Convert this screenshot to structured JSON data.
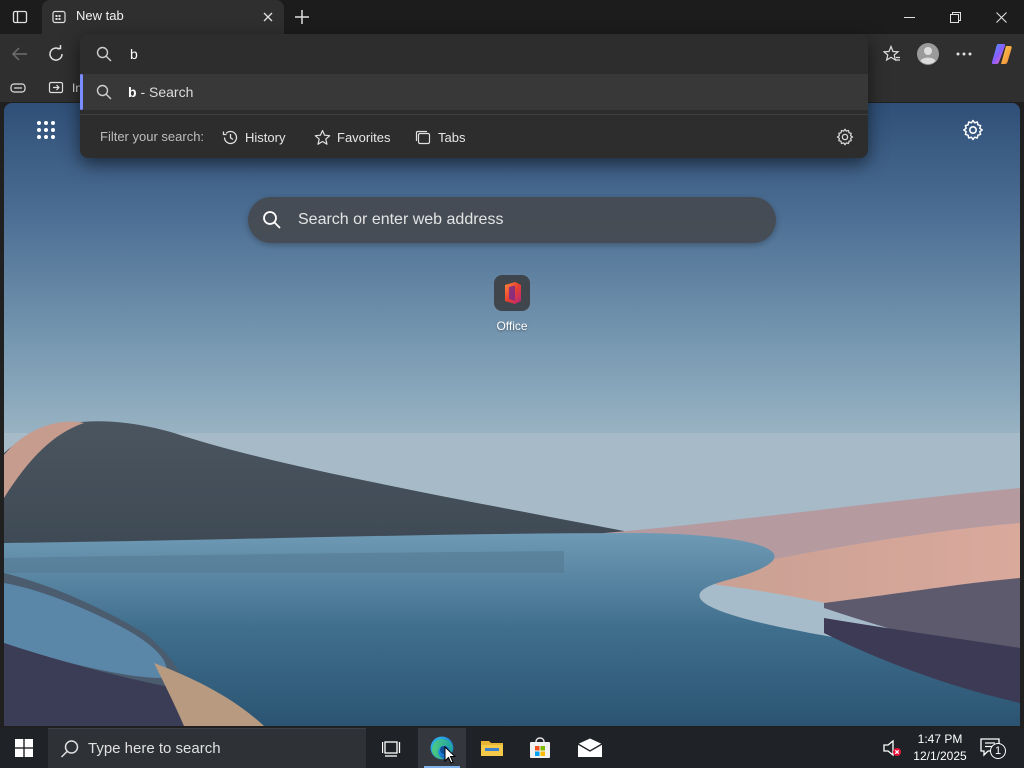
{
  "browser": {
    "tab": {
      "title": "New tab"
    },
    "favorites_bar": {
      "partial_label": "In"
    },
    "omnibox": {
      "typed_text": "b",
      "suggestion": {
        "bold": "b",
        "rest": " - Search"
      },
      "filter_label": "Filter your search:",
      "filters": [
        {
          "label": "History",
          "icon": "history-icon"
        },
        {
          "label": "Favorites",
          "icon": "star-icon"
        },
        {
          "label": "Tabs",
          "icon": "tabs-icon"
        }
      ]
    },
    "new_tab_page": {
      "search_placeholder": "Search or enter web address",
      "tiles": [
        {
          "label": "Office",
          "icon": "office-icon"
        }
      ]
    }
  },
  "taskbar": {
    "search_placeholder": "Type here to search",
    "time": "1:47 PM",
    "date": "12/1/2025",
    "notification_count": "1"
  },
  "colors": {
    "accent": "#7a8cff",
    "title_bar": "#1c1c1c",
    "toolbar": "#2f2f2f",
    "taskbar": "#1f2226"
  }
}
